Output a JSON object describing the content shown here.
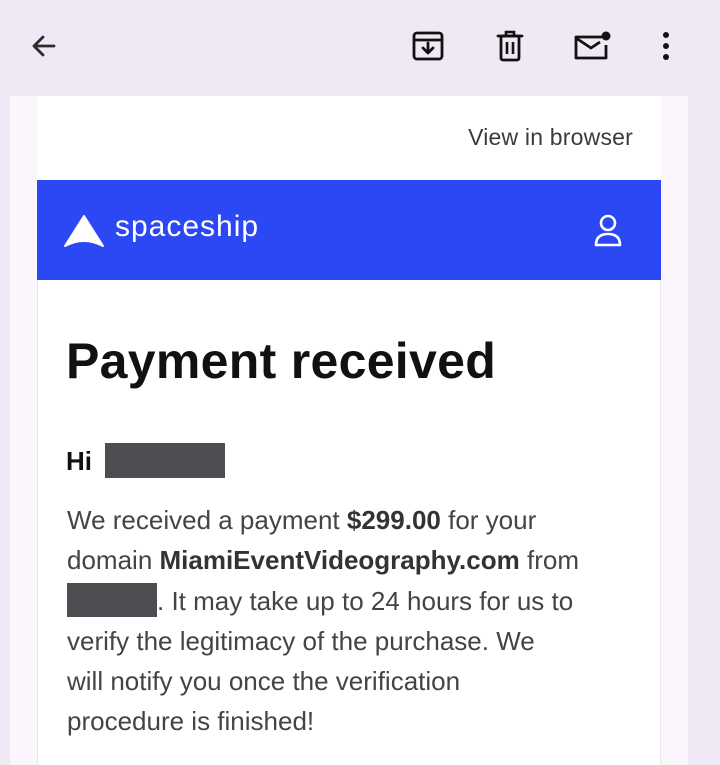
{
  "toolbar": {
    "back_icon": "arrow-back-icon",
    "archive_icon": "archive-icon",
    "delete_icon": "trash-icon",
    "mark_unread_icon": "mail-unread-icon",
    "more_icon": "more-vertical-icon"
  },
  "email": {
    "view_in_browser": "View in browser",
    "brand": {
      "name": "spaceship",
      "logo_icon": "spaceship-logo-icon",
      "account_icon": "user-icon",
      "band_color": "#2c48f5"
    },
    "headline": "Payment received",
    "greeting": "Hi",
    "body": {
      "part1": "We received a payment ",
      "amount": "$299.00",
      "part2": " for your",
      "part3": "domain ",
      "domain": "MiamiEventVideography.com",
      "part4": " from",
      "part5": ". It may take up to 24 hours for us to",
      "line4": "verify the legitimacy of the purchase. We",
      "line5": "will notify you once the verification",
      "line6": "procedure is finished!"
    }
  }
}
